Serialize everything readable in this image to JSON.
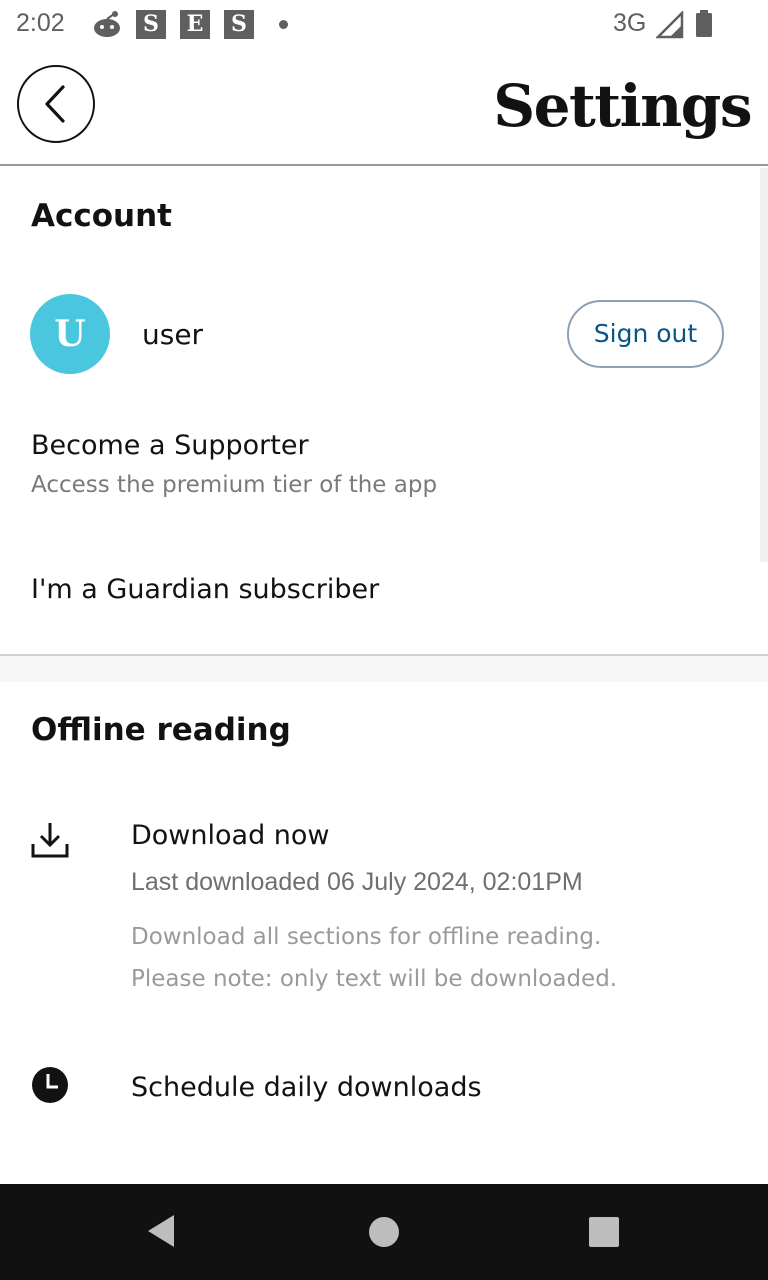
{
  "status_bar": {
    "time": "2:02",
    "tiles": [
      "S",
      "E",
      "S"
    ],
    "network": "3G",
    "icons": [
      "reddit-icon",
      "dot-icon",
      "signal-icon",
      "battery-icon"
    ]
  },
  "header": {
    "title": "Settings",
    "back_icon": "chevron-left-icon"
  },
  "account": {
    "heading": "Account",
    "avatar_letter": "U",
    "username": "user",
    "sign_out_label": "Sign out",
    "supporter_title": "Become a Supporter",
    "supporter_subtitle": "Access the premium tier of the app",
    "subscriber_title": "I'm a Guardian subscriber"
  },
  "offline": {
    "heading": "Offline reading",
    "download_title": "Download now",
    "last_downloaded": "Last downloaded 06 July 2024, 02:01PM",
    "note_line_1": "Download all sections for offline reading.",
    "note_line_2": "Please note: only text will be downloaded.",
    "schedule_title": "Schedule daily downloads"
  },
  "colors": {
    "avatar": "#4bc6df",
    "sign_out_text": "#0a5488",
    "nav_bar": "#111111"
  }
}
